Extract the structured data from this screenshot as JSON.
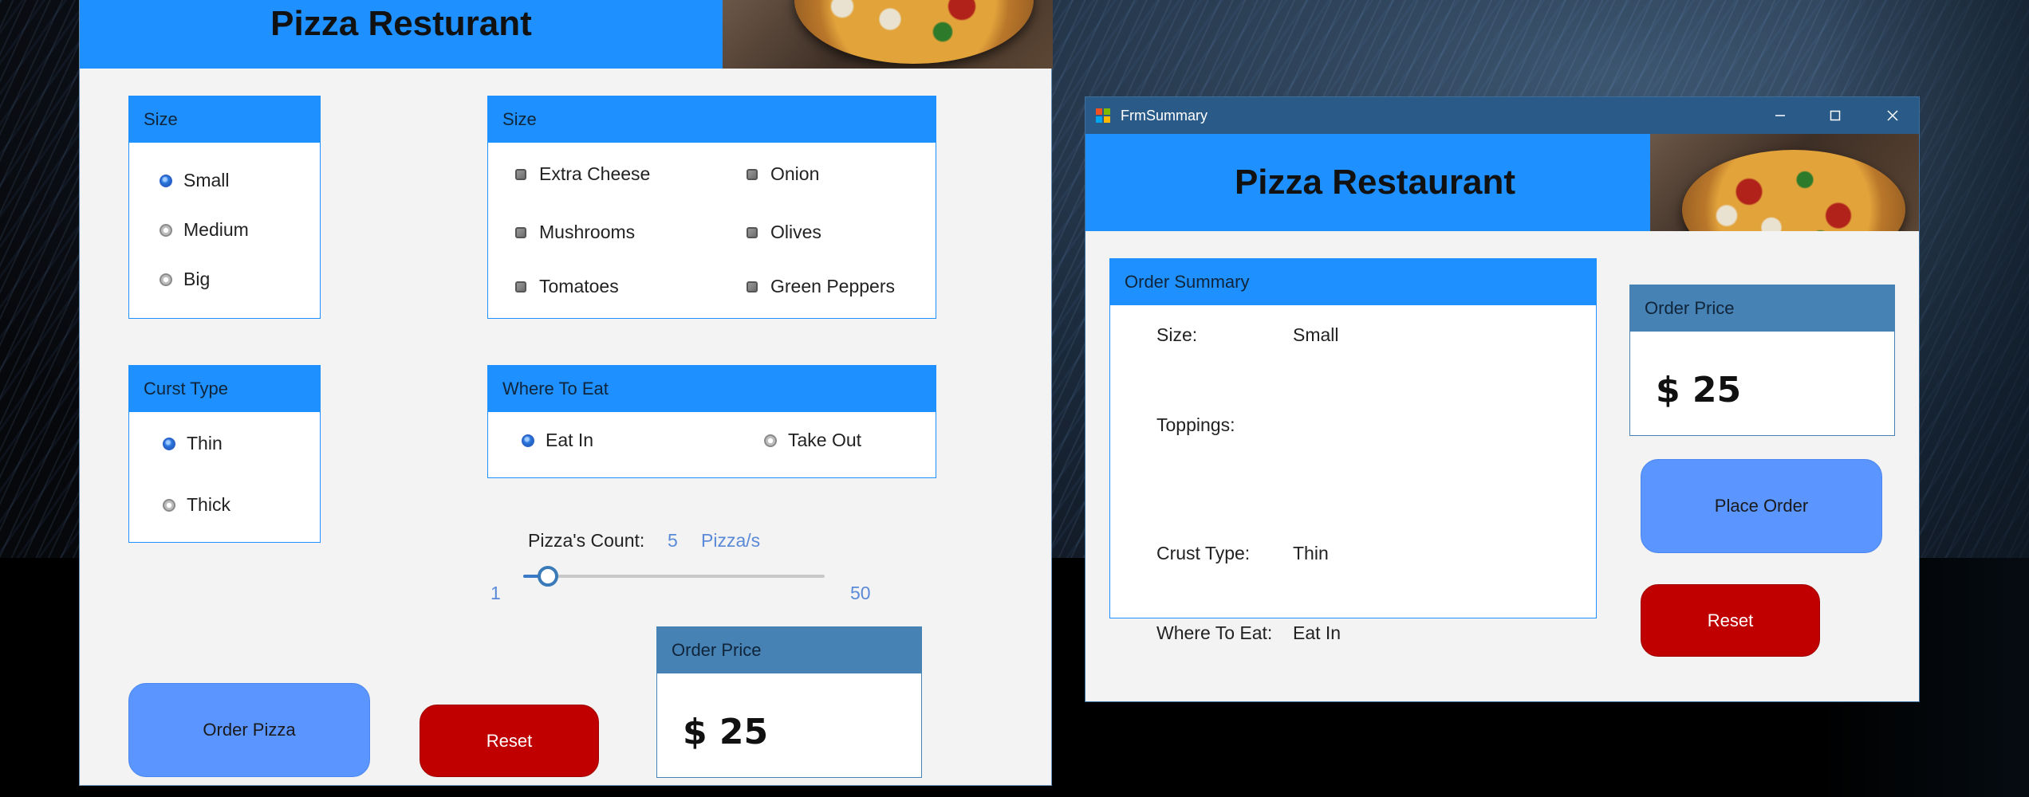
{
  "main_form": {
    "title": "Pizza Resturant",
    "size_group": {
      "header": "Size",
      "options": [
        {
          "label": "Small",
          "selected": true
        },
        {
          "label": "Medium",
          "selected": false
        },
        {
          "label": "Big",
          "selected": false
        }
      ]
    },
    "toppings_group": {
      "header": "Size",
      "options": [
        "Extra Cheese",
        "Onion",
        "Mushrooms",
        "Olives",
        "Tomatoes",
        "Green Peppers"
      ]
    },
    "crust_group": {
      "header": "Curst Type",
      "options": [
        {
          "label": "Thin",
          "selected": true
        },
        {
          "label": "Thick",
          "selected": false
        }
      ]
    },
    "where_group": {
      "header": "Where To Eat",
      "options": [
        {
          "label": "Eat In",
          "selected": true
        },
        {
          "label": "Take Out",
          "selected": false
        }
      ]
    },
    "count": {
      "label": "Pizza's Count:",
      "value": "5",
      "unit": "Pizza/s",
      "min": "1",
      "max": "50",
      "slider_value": 5
    },
    "order_price": {
      "header": "Order Price",
      "value": "$ 25"
    },
    "order_button": "Order Pizza",
    "reset_button": "Reset"
  },
  "summary_window": {
    "window_title": "FrmSummary",
    "title": "Pizza Restaurant",
    "summary_group": {
      "header": "Order Summary",
      "rows": [
        {
          "label": "Size:",
          "value": "Small"
        },
        {
          "label": "Toppings:",
          "value": ""
        },
        {
          "label": "Crust Type:",
          "value": "Thin"
        },
        {
          "label": "Where To Eat:",
          "value": "Eat In"
        }
      ]
    },
    "order_price": {
      "header": "Order Price",
      "value": "$ 25"
    },
    "place_order_button": "Place Order",
    "reset_button": "Reset"
  },
  "colors": {
    "header_blue": "#1e90ff",
    "price_header": "#4682b4",
    "button_blue": "#5b95ff",
    "button_red": "#c00000",
    "titlebar": "#2a5b88"
  },
  "icons": [
    "app-icon",
    "minimize-icon",
    "maximize-icon",
    "close-icon",
    "pizza-image"
  ]
}
